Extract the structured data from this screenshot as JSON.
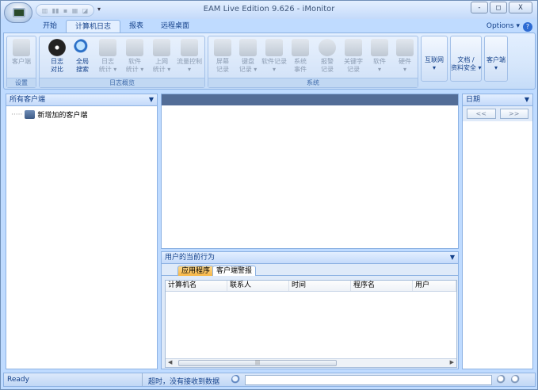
{
  "window": {
    "title": "EAM Live Edition 9.626 - iMonitor",
    "controls": {
      "minimize": "-",
      "maximize": "□",
      "close": "X"
    }
  },
  "quick_access": {
    "icons": [
      "toolbar-icon-1",
      "toolbar-icon-2",
      "toolbar-icon-3",
      "toolbar-icon-4",
      "toolbar-icon-5"
    ],
    "dropdown": "▾"
  },
  "tabs": [
    {
      "label": "开始"
    },
    {
      "label": "计算机日志",
      "active": true
    },
    {
      "label": "报表"
    },
    {
      "label": "远程桌面"
    }
  ],
  "options_label": "Options",
  "help_label": "?",
  "ribbon": {
    "groups": {
      "settings": {
        "label": "设置",
        "buttons": [
          {
            "label": "客户端",
            "enabled": false
          }
        ]
      },
      "log_overview": {
        "label": "日志概览",
        "buttons": [
          {
            "label": "日志\n对比",
            "enabled": true
          },
          {
            "label": "全局\n搜索",
            "enabled": true
          },
          {
            "label": "日志\n统计 ▾",
            "enabled": false
          },
          {
            "label": "软件\n统计 ▾",
            "enabled": false
          },
          {
            "label": "上网\n统计 ▾",
            "enabled": false
          },
          {
            "label": "流量控制\n▾",
            "enabled": false
          }
        ]
      },
      "system": {
        "label": "系统",
        "buttons": [
          {
            "label": "屏幕\n记录",
            "enabled": false
          },
          {
            "label": "键盘\n记录 ▾",
            "enabled": false
          },
          {
            "label": "软件记录\n▾",
            "enabled": false
          },
          {
            "label": "系统\n事件",
            "enabled": false
          },
          {
            "label": "报警\n记录",
            "enabled": false
          },
          {
            "label": "关键字\n记录",
            "enabled": false
          },
          {
            "label": "软件\n▾",
            "enabled": false
          },
          {
            "label": "硬件\n▾",
            "enabled": false
          }
        ]
      }
    },
    "big_buttons": [
      {
        "label": "互联网\n▾"
      },
      {
        "label": "文档 /\n资料安全 ▾"
      },
      {
        "label": "客户端\n▾"
      }
    ]
  },
  "left_panel": {
    "title": "所有客户端",
    "tree": [
      {
        "label": "新增加的客户端"
      }
    ]
  },
  "right_panel": {
    "title": "日期",
    "prev": "<<",
    "next": ">>"
  },
  "activity_panel": {
    "title": "用户的当前行为",
    "tabs": [
      {
        "label": "应用程序"
      },
      {
        "label": "客户端警报"
      }
    ],
    "columns": [
      "计算机名",
      "联系人",
      "时间",
      "程序名",
      "用户"
    ]
  },
  "status_bar": {
    "ready": "Ready",
    "message": "超时，没有接收到数据"
  }
}
